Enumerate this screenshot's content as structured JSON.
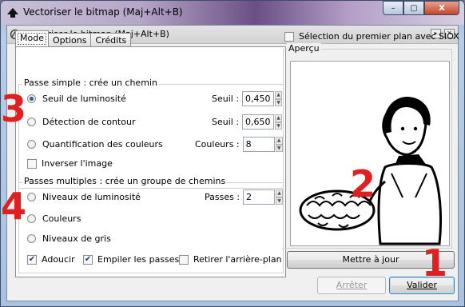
{
  "window": {
    "title": "Vectoriser le bitmap (Maj+Alt+B)",
    "caption_buttons": [
      "–",
      "▢",
      "X"
    ]
  },
  "dialog": {
    "title": "Vectoriser le bitmap (Maj+Alt+B)"
  },
  "tabs": [
    {
      "label": "Mode",
      "active": true
    },
    {
      "label": "Options",
      "active": false
    },
    {
      "label": "Crédits",
      "active": false
    }
  ],
  "single_pass": {
    "label": "Passe simple : crée un chemin",
    "options": [
      {
        "label": "Seuil de luminosité",
        "checked": true,
        "spin_label": "Seuil :",
        "spin_value": "0,450"
      },
      {
        "label": "Détection de contour",
        "checked": false,
        "spin_label": "Seuil :",
        "spin_value": "0,650"
      },
      {
        "label": "Quantification des couleurs",
        "checked": false,
        "spin_label": "Couleurs :",
        "spin_value": "8"
      }
    ],
    "invert_label": "Inverser l'image",
    "invert_checked": false
  },
  "multi_pass": {
    "label": "Passes multiples : crée un groupe de chemins",
    "options": [
      {
        "label": "Niveaux de luminosité",
        "checked": false,
        "spin_label": "Passes :",
        "spin_value": "2"
      },
      {
        "label": "Couleurs",
        "checked": false
      },
      {
        "label": "Niveaux de gris",
        "checked": false
      }
    ],
    "smooth_label": "Adoucir",
    "smooth_checked": true,
    "stack_label": "Empiler les passes",
    "stack_checked": true,
    "remove_bg_label": "Retirer l'arrière-plan",
    "remove_bg_checked": false
  },
  "siox": {
    "label": "Sélection du premier plan avec SIOX",
    "checked": false
  },
  "preview": {
    "label": "Aperçu",
    "update_button": "Mettre à jour"
  },
  "footer": {
    "cancel_button": "Arrêter",
    "ok_button": "Valider"
  },
  "annotations": [
    "1",
    "2",
    "3",
    "4"
  ],
  "colors": {
    "annotation": "#e02020",
    "accent": "#2b5aa0"
  }
}
